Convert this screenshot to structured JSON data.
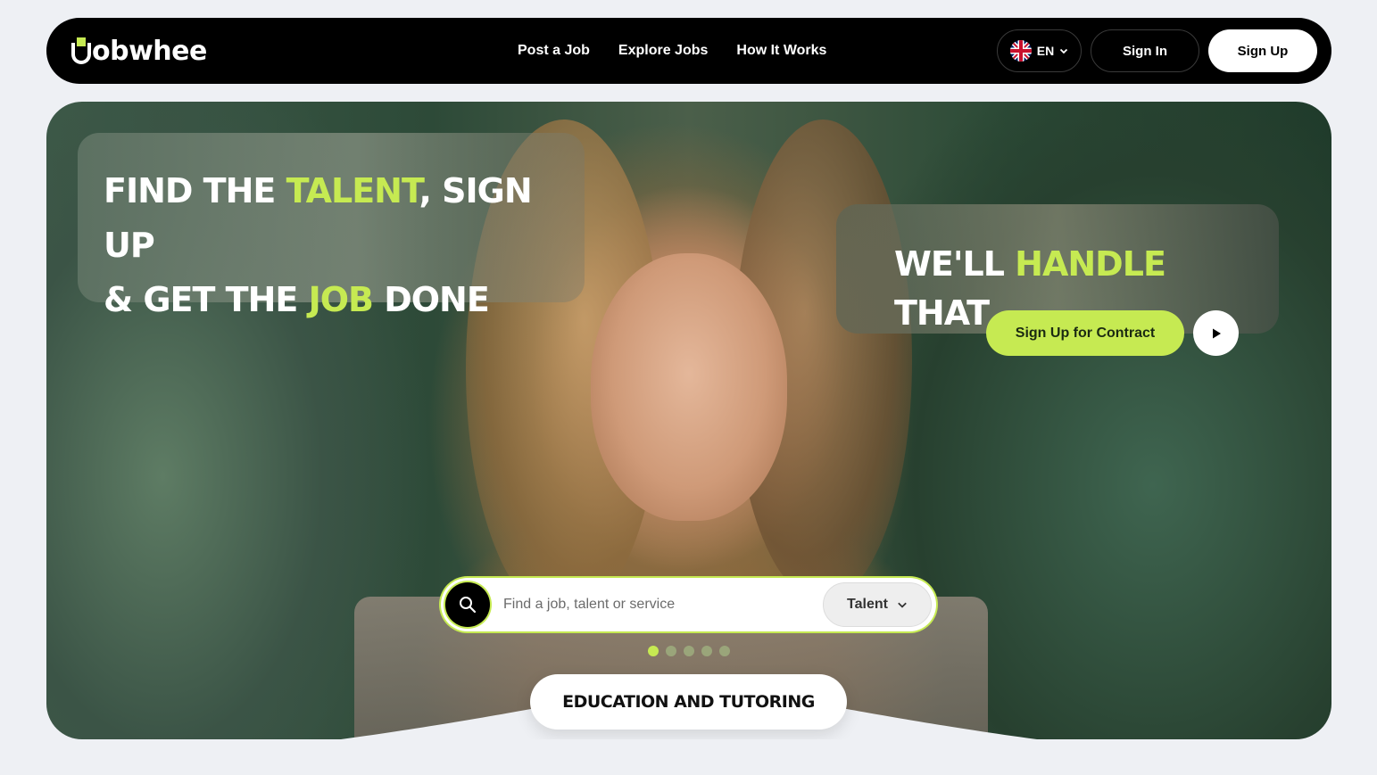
{
  "brand": {
    "logo_text": "obwhee",
    "accent_color": "#c6ea52"
  },
  "nav": {
    "links": [
      "Post a Job",
      "Explore Jobs",
      "How It Works"
    ],
    "language": {
      "code": "EN",
      "flag_icon": "uk-flag-icon"
    },
    "sign_in": "Sign In",
    "sign_up": "Sign Up"
  },
  "hero": {
    "headline_left": {
      "part1": "FIND THE ",
      "highlight1": "TALENT",
      "part2": ", SIGN UP",
      "part3": "& GET THE ",
      "highlight2": "JOB",
      "part4": " DONE"
    },
    "headline_right": {
      "part1": "WE'LL ",
      "highlight": "HANDLE",
      "part2": " THAT"
    },
    "cta_label": "Sign Up for Contract",
    "play_icon": "play-icon",
    "search": {
      "placeholder": "Find a job, talent or service",
      "value": "",
      "category": "Talent"
    },
    "carousel": {
      "count": 5,
      "active_index": 0
    },
    "category_pill": "EDUCATION AND TUTORING"
  }
}
